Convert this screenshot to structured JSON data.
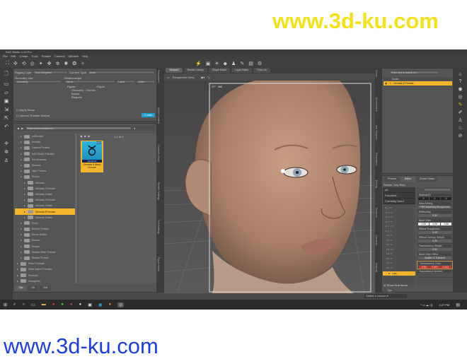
{
  "watermark_top": "www.3d-ku.com",
  "watermark_bottom": "www.3d-ku.com",
  "window": {
    "title": "DAZ Studio 4.12 Pro"
  },
  "menu": [
    "File",
    "Edit",
    "Create",
    "Tools",
    "Render",
    "Connect",
    "Window",
    "Help"
  ],
  "figure_setup": {
    "rigging_type_label": "Rigging Type",
    "rigging_type_value": "Triax Weighted",
    "content_type_label": "Content Type",
    "content_type_value": "Actor",
    "geometry_list": "Geometry List",
    "geometry_col": "Geometry",
    "hierarchy": "Relationships",
    "cols": [
      "Name",
      "Label",
      "Order"
    ],
    "tree": [
      "Figure",
      "Geometry - Human",
      "Bones",
      "Regions"
    ],
    "figure_label": "Figure",
    "apply_label": "Apply Setup",
    "launch_label": "Launch Transfer Wizard",
    "create_button": "Create"
  },
  "library": {
    "search_placeholder": "Enter text to search for...",
    "page_counter": "1-1 of 1",
    "folders": [
      {
        "label": "anfReview",
        "level": 0
      },
      {
        "label": "Animals",
        "level": 0
      },
      {
        "label": "Camera Presets",
        "level": 0
      },
      {
        "label": "DAZ Studio Tutorials",
        "level": 0
      },
      {
        "label": "DzUniversals",
        "level": 0
      },
      {
        "label": "General",
        "level": 0
      },
      {
        "label": "Light Presets",
        "level": 0
      },
      {
        "label": "People",
        "level": 0
      },
      {
        "label": "Genesis",
        "level": 1
      },
      {
        "label": "Genesis 2 Female",
        "level": 1
      },
      {
        "label": "Genesis 2 Male",
        "level": 1
      },
      {
        "label": "Genesis 3 Female",
        "level": 1
      },
      {
        "label": "Genesis 3 Male",
        "level": 1
      },
      {
        "label": "Genesis 8 Female",
        "level": 1,
        "selected": true
      },
      {
        "label": "Genesis 8 Male",
        "level": 1
      },
      {
        "label": "Props",
        "level": 0
      },
      {
        "label": "Render Presets",
        "level": 0
      },
      {
        "label": "Scene Builder",
        "level": 0
      },
      {
        "label": "Scenes",
        "level": 0
      },
      {
        "label": "Scripts",
        "level": 0
      },
      {
        "label": "Shader Mixer Tutorial",
        "level": 0
      },
      {
        "label": "Shader Presets",
        "level": 0
      },
      {
        "label": "Poser Formats",
        "level": -1
      },
      {
        "label": "Other Import Formats",
        "level": -1
      },
      {
        "label": "Products",
        "level": -1
      },
      {
        "label": "Categories",
        "level": -1
      }
    ],
    "item": {
      "badge": "Actor",
      "brand": "GENESIS",
      "name": "Genesis 8 Basic Female"
    },
    "footer_tabs": [
      "Tips",
      "Lib",
      "Sub"
    ]
  },
  "left_vtabs": [
    "Parameters",
    "Smart Content",
    "Content Library",
    "Render Settings",
    "Tool Settings",
    "Figure Setup"
  ],
  "viewport": {
    "tabs": [
      "Viewport",
      "Render Library",
      "Shape Match",
      "Layer Editor",
      "Pose Lib"
    ],
    "view_label": "Perspective View",
    "frame_label": "277 · 366"
  },
  "scene": {
    "search_placeholder": "Enter text to search for...",
    "cols": [
      "Node"
    ],
    "node": "Genesis 8 Female"
  },
  "right_vtabs": [
    "Scene",
    "Environment",
    "Aux Viewport",
    "Parameters",
    "Posing",
    "Surfaces",
    "Cameras",
    "Shaping"
  ],
  "surfaces": {
    "tabs": [
      "Presets",
      "Editor",
      "Shader Baker"
    ],
    "shown_label": "Shown:",
    "shown_value": "Key Misc",
    "filters": [
      "All",
      "Favorites",
      "Currently Used"
    ],
    "selected_surface": "Lips",
    "show_sub_items": "Show Sub Items",
    "props": [
      {
        "label": "Material ID",
        "values": [
          "0",
          "0",
          "0"
        ]
      },
      {
        "label": "Seed Mixing",
        "values": [
          "PBR Metallicity/Roughness"
        ]
      },
      {
        "label": "Reflectivity",
        "values": [
          "0.50"
        ]
      },
      {
        "label": "Base Color",
        "values": [
          "1.00",
          "1.00",
          "1.00"
        ]
      },
      {
        "label": "Diffuse Roughness",
        "values": [
          "0.00"
        ]
      },
      {
        "label": "Diffuse Overlay Weight",
        "values": [
          "0.00"
        ]
      },
      {
        "label": "Translucency Weight",
        "values": [
          "0.50"
        ]
      },
      {
        "label": "Base Color Effect",
        "values": [
          "Scatter & Transmit"
        ]
      },
      {
        "label": "Translucency Color",
        "values": [
          "0.30",
          "0.607",
          "0.012"
        ]
      },
      {
        "label": "Transmission Normal",
        "values": []
      }
    ],
    "footer_tab": "Tips",
    "lesson_select": "Select a Lesson"
  },
  "taskbar": {
    "time": "3:27 PM"
  },
  "colors": {
    "accent": "#f2b52c",
    "bg": "#4a4a4a",
    "panel": "#555555"
  }
}
